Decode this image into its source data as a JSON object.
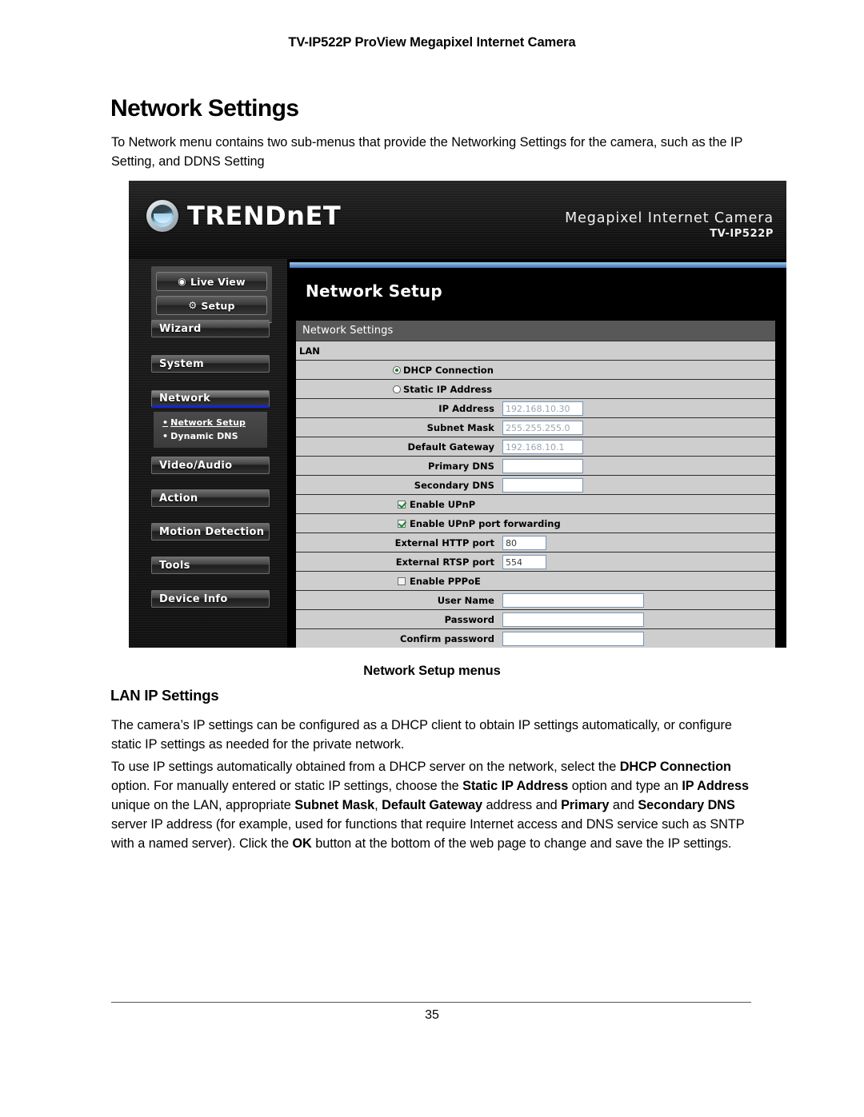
{
  "document": {
    "running_header": "TV-IP522P ProView Megapixel Internet Camera",
    "page_title": "Network Settings",
    "intro_paragraph": "To Network menu contains two sub-menus that provide the Networking Settings for the camera, such as the IP Setting, and DDNS Setting",
    "figure_caption": "Network Setup menus",
    "section_heading": "LAN IP Settings",
    "paragraph_1": "The camera’s IP settings can be configured as a DHCP client to obtain IP settings automatically, or configure static IP settings as needed for the private network.",
    "paragraph_2_runs": [
      {
        "text": "To use IP settings automatically obtained from a DHCP server on the network, select the ",
        "bold": false
      },
      {
        "text": "DHCP Connection",
        "bold": true
      },
      {
        "text": " option. For manually entered or static IP settings, choose the ",
        "bold": false
      },
      {
        "text": "Static IP Address",
        "bold": true
      },
      {
        "text": " option and type an ",
        "bold": false
      },
      {
        "text": "IP Address",
        "bold": true
      },
      {
        "text": " unique on the LAN, appropriate ",
        "bold": false
      },
      {
        "text": "Subnet Mask",
        "bold": true
      },
      {
        "text": ", ",
        "bold": false
      },
      {
        "text": "Default Gateway",
        "bold": true
      },
      {
        "text": " address and ",
        "bold": false
      },
      {
        "text": "Primary",
        "bold": true
      },
      {
        "text": " and ",
        "bold": false
      },
      {
        "text": "Secondary DNS",
        "bold": true
      },
      {
        "text": " server IP address (for example, used for functions that require Internet access and DNS service such as SNTP with a named server). Click the ",
        "bold": false
      },
      {
        "text": "OK",
        "bold": true
      },
      {
        "text": " button at the bottom of the web page to change and save the IP settings.",
        "bold": false
      }
    ],
    "page_number": "35"
  },
  "screenshot": {
    "banner": {
      "brand": "TRENDnET",
      "brand_text": "TRENDnET",
      "product_line": "Megapixel Internet Camera",
      "model": "TV-IP522P",
      "logo_icon": "trendnet-globe-icon"
    },
    "nav": {
      "mode_buttons": [
        {
          "label": "Live View",
          "icon": "eye-icon",
          "glyph": "◉"
        },
        {
          "label": "Setup",
          "icon": "gear-icon",
          "glyph": "⚙"
        }
      ],
      "items": [
        {
          "label": "Wizard",
          "active": false
        },
        {
          "label": "System",
          "active": false
        },
        {
          "label": "Network",
          "active": true
        },
        {
          "label": "Video/Audio",
          "active": false
        },
        {
          "label": "Action",
          "active": false
        },
        {
          "label": "Motion Detection",
          "active": false
        },
        {
          "label": "Tools",
          "active": false
        },
        {
          "label": "Device Info",
          "active": false
        }
      ],
      "submenu": [
        {
          "label": "Network Setup",
          "current": true
        },
        {
          "label": "Dynamic DNS",
          "current": false
        }
      ]
    },
    "content": {
      "heading": "Network Setup",
      "panel_title": "Network Settings",
      "section_label": "LAN",
      "radio_dhcp": {
        "label": "DHCP Connection",
        "selected": true
      },
      "radio_static": {
        "label": "Static IP Address",
        "selected": false
      },
      "fields": [
        {
          "label": "IP Address",
          "value": "192.168.10.30"
        },
        {
          "label": "Subnet Mask",
          "value": "255.255.255.0"
        },
        {
          "label": "Default Gateway",
          "value": "192.168.10.1"
        },
        {
          "label": "Primary DNS",
          "value": ""
        },
        {
          "label": "Secondary DNS",
          "value": ""
        }
      ],
      "check_upnp": {
        "label": "Enable UPnP",
        "checked": true
      },
      "check_upnp_forward": {
        "label": "Enable UPnP port forwarding",
        "checked": true
      },
      "ports": [
        {
          "label": "External HTTP port",
          "value": "80"
        },
        {
          "label": "External RTSP port",
          "value": "554"
        }
      ],
      "check_pppoe": {
        "label": "Enable PPPoE",
        "checked": false
      },
      "credentials": [
        {
          "label": "User Name",
          "value": ""
        },
        {
          "label": "Password",
          "value": ""
        },
        {
          "label": "Confirm password",
          "value": ""
        }
      ]
    }
  },
  "colors": {
    "accent_blue": "#3e74b4",
    "panel_bg": "#cecece",
    "panel_title_bg": "#585858",
    "nav_active_underline": "#1226d6",
    "radio_dot_green": "#1d7a2f"
  }
}
